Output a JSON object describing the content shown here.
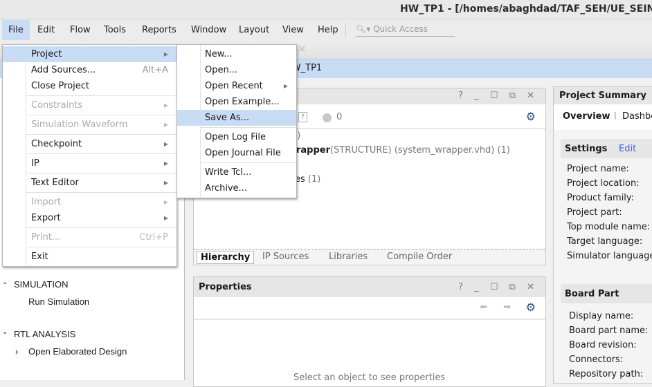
{
  "window": {
    "title": "HW_TP1 - [/homes/abaghdad/TAF_SEH/UE_SEIN"
  },
  "menubar": {
    "items": [
      {
        "label": "File",
        "mn": "F"
      },
      {
        "label": "Edit",
        "mn": "E"
      },
      {
        "label": "Flow",
        "mn": "l"
      },
      {
        "label": "Tools",
        "mn": "T"
      },
      {
        "label": "Reports",
        "mn": "o"
      },
      {
        "label": "Window",
        "mn": "W"
      },
      {
        "label": "Layout",
        "mn": "y"
      },
      {
        "label": "View",
        "mn": "V"
      },
      {
        "label": "Help",
        "mn": "H"
      }
    ],
    "quick_access_placeholder": "Quick Access"
  },
  "project_bar": {
    "name": "HW_TP1"
  },
  "file_menu": [
    {
      "label": "Project",
      "mn": "",
      "arrow": true,
      "highlighted": true
    },
    {
      "label": "Add Sources...",
      "mn": "u",
      "shortcut": "Alt+A"
    },
    {
      "label": "Close Project",
      "mn": "C"
    },
    {
      "sep": true
    },
    {
      "label": "Constraints",
      "mn": "",
      "arrow": true,
      "disabled": true
    },
    {
      "sep": true
    },
    {
      "label": "Simulation Waveform",
      "mn": "a",
      "arrow": true,
      "disabled": true
    },
    {
      "sep": true
    },
    {
      "label": "Checkpoint",
      "mn": "k",
      "arrow": true
    },
    {
      "sep": true
    },
    {
      "label": "IP",
      "mn": "I",
      "arrow": true
    },
    {
      "sep": true
    },
    {
      "label": "Text Editor",
      "mn": "d",
      "arrow": true
    },
    {
      "sep": true
    },
    {
      "label": "Import",
      "mn": "m",
      "arrow": true,
      "disabled": true
    },
    {
      "label": "Export",
      "mn": "t",
      "arrow": true
    },
    {
      "sep": true
    },
    {
      "label": "Print...",
      "mn": "P",
      "shortcut": "Ctrl+P",
      "disabled": true
    },
    {
      "sep": true
    },
    {
      "label": "Exit",
      "mn": "x"
    }
  ],
  "project_submenu": [
    {
      "label": "New...",
      "mn": "N"
    },
    {
      "label": "Open...",
      "mn": "O"
    },
    {
      "label": "Open Recent",
      "mn": "R",
      "arrow": true
    },
    {
      "label": "Open Example...",
      "mn": "a"
    },
    {
      "label": "Save As...",
      "mn": "S",
      "highlighted": true
    },
    {
      "sep": true
    },
    {
      "label": "Open Log File",
      "mn": "g"
    },
    {
      "label": "Open Journal File",
      "mn": "J"
    },
    {
      "sep": true
    },
    {
      "label": "Write Tcl...",
      "mn": "t"
    },
    {
      "label": "Archive...",
      "mn": "h"
    }
  ],
  "flow_nav": {
    "simulation": {
      "header": "SIMULATION",
      "items": [
        "Run Simulation"
      ]
    },
    "rtl": {
      "header": "RTL ANALYSIS",
      "items": [
        "Open Elaborated Design"
      ]
    }
  },
  "sources": {
    "controls": "? _ ☐ ⧉ ✕",
    "count": "0",
    "rows": {
      "r1": "1)",
      "r2_bold": "rapper",
      "r2_rest": "(STRUCTURE) (system_wrapper.vhd) (1)",
      "r3": "es",
      "r3_count": "(1)"
    },
    "tabs": [
      "Hierarchy",
      "IP Sources",
      "Libraries",
      "Compile Order"
    ]
  },
  "properties": {
    "title": "Properties",
    "controls": "? _ ☐ ⧉ ✕",
    "empty": "Select an object to see properties"
  },
  "summary": {
    "title": "Project Summary",
    "tabs": [
      "Overview",
      "|",
      "Dashbo"
    ],
    "settings": {
      "header": "Settings",
      "edit": "Edit",
      "labels": [
        "Project name:",
        "Project location:",
        "Product family:",
        "Project part:",
        "Top module name:",
        "Target language:",
        "Simulator language"
      ]
    },
    "board": {
      "header": "Board Part",
      "labels": [
        "Display name:",
        "Board part name:",
        "Board revision:",
        "Connectors:",
        "Repository path:"
      ]
    }
  },
  "colors": {
    "highlight": "#c9dcf6",
    "accent": "#2e4f7e",
    "link": "#3366ee"
  }
}
